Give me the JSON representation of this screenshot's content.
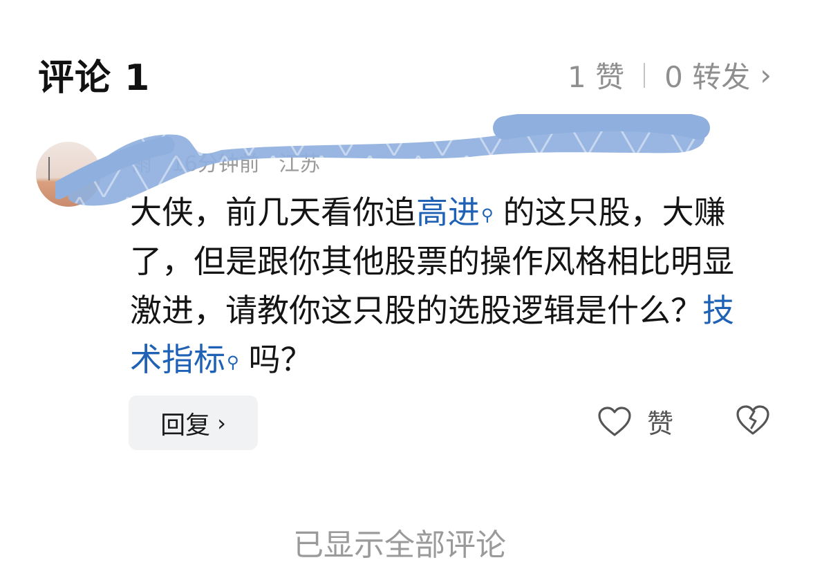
{
  "header": {
    "title": "评论 1",
    "likes": "1 赞",
    "reposts": "0 转发",
    "chevron": "›"
  },
  "comment": {
    "meta": {
      "author": "雨",
      "time": "16分钟前",
      "location": "江苏"
    },
    "text_parts": {
      "p1": "大侠，前几天看你追",
      "link1": "高进",
      "p2": "的这只股，大赚了，但是跟你其他股票的操作风格相比明显激进，请教你这只股的选股逻辑是什么？",
      "link2": "技术指标",
      "p3": "吗？"
    },
    "link_color": "#1f62b5",
    "reply_label": "回复",
    "like_label": "赞"
  },
  "footer": {
    "text": "已显示全部评论"
  },
  "icons": {
    "heart": "heart-outline-icon",
    "broken_heart": "broken-heart-icon",
    "search": "search-icon",
    "chevron": "chevron-right-icon"
  }
}
